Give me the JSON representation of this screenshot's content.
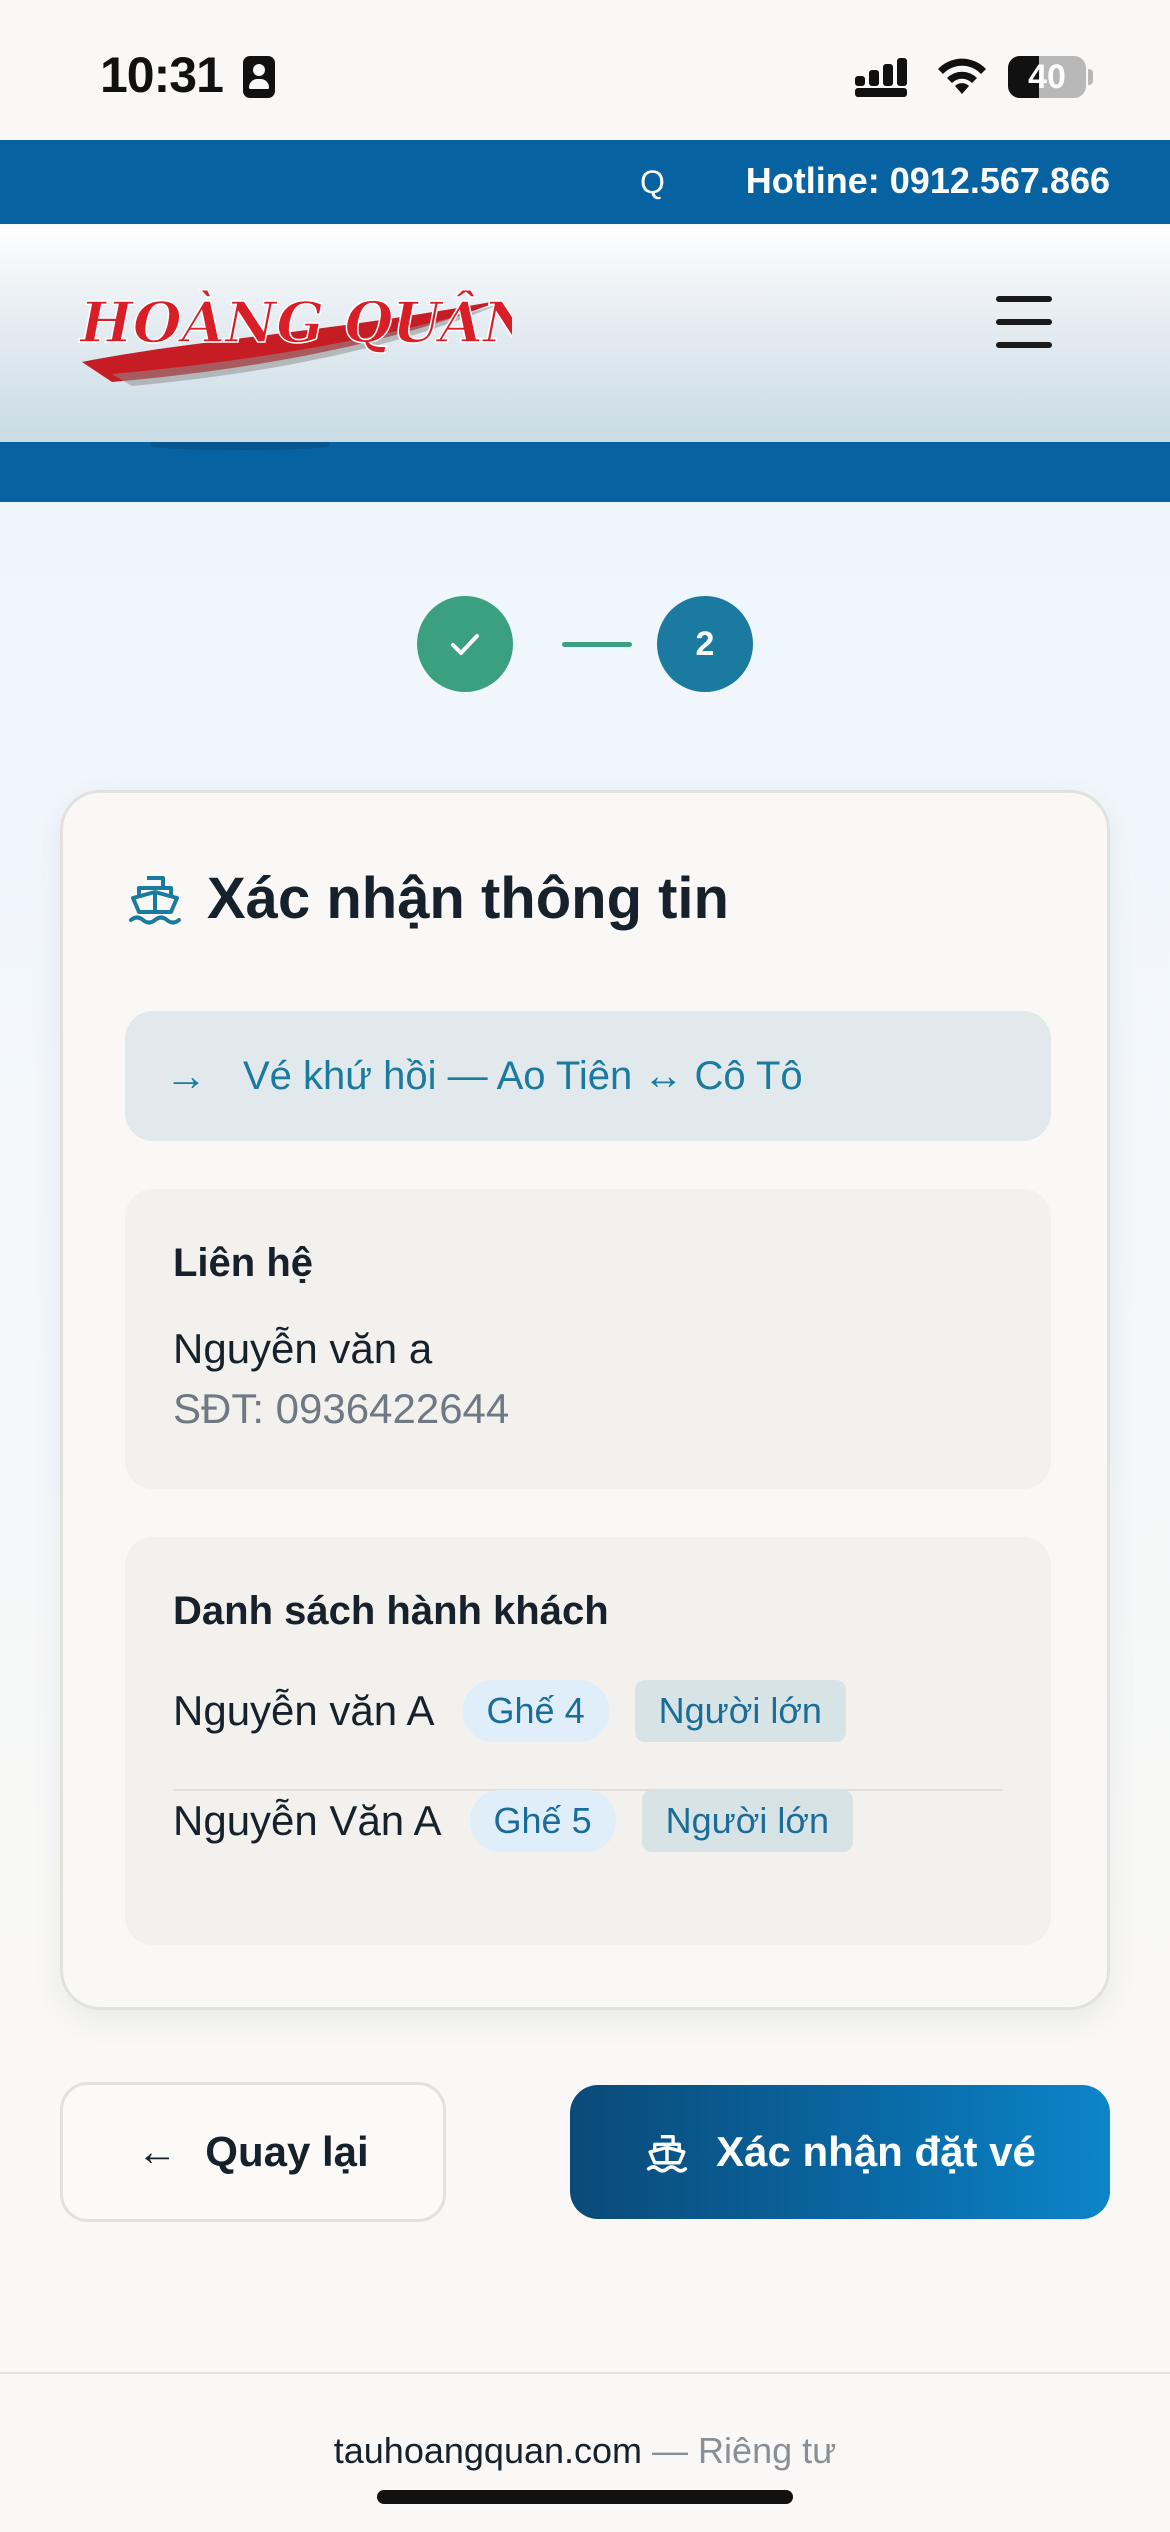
{
  "status_bar": {
    "time": "10:31",
    "battery_level": "40",
    "battery_fraction": 0.4
  },
  "top_bar": {
    "search_icon": "Q",
    "hotline": "Hotline: 0912.567.866"
  },
  "header": {
    "logo_text": "HOÀNG QUÂN",
    "menu_icon": "hamburger-menu-icon"
  },
  "stepper": {
    "step1_icon": "check-icon",
    "step2_label": "2"
  },
  "card": {
    "title": "Xác nhận thông tin",
    "title_icon": "ship-icon",
    "route": "Vé khứ hồi — Ao Tiên ↔ Cô Tô",
    "route_icon": "arrow-right-icon",
    "contact": {
      "heading": "Liên hệ",
      "name": "Nguyễn văn a",
      "phone": "SĐT: 0936422644"
    },
    "passengers": {
      "heading": "Danh sách hành khách",
      "rows": [
        {
          "name": "Nguyễn văn A",
          "seat": "Ghế 4",
          "type": "Người lớn"
        },
        {
          "name": "Nguyễn Văn A",
          "seat": "Ghế 5",
          "type": "Người lớn"
        }
      ]
    }
  },
  "actions": {
    "back_label": "Quay lại",
    "confirm_label": "Xác nhận đặt vé"
  },
  "footer": {
    "domain": "tauhoangquan.com",
    "separator": "—",
    "privacy": "Riêng tư"
  },
  "colors": {
    "brand_blue": "#0762a2",
    "accent_teal": "#1a7aa0",
    "success_green": "#3aa07f",
    "logo_red": "#d81e27"
  }
}
